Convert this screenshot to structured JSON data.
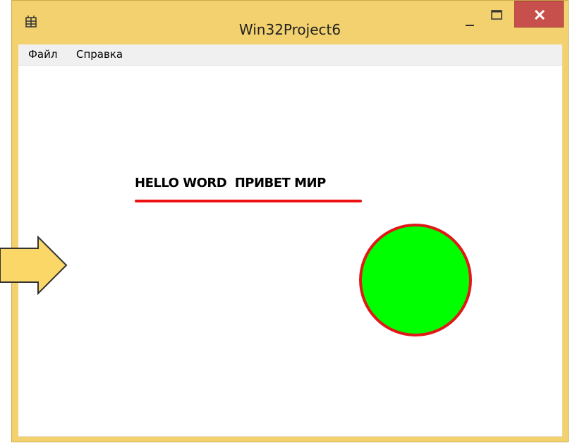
{
  "window": {
    "title": "Win32Project6",
    "frame_color": "#f2d16e",
    "close_button_color": "#c7504c"
  },
  "menu": {
    "items": [
      {
        "label": "Файл"
      },
      {
        "label": "Справка"
      }
    ]
  },
  "canvas": {
    "text": "HELLO WORD  ПРИВЕТ МИР",
    "text_color": "#000000",
    "underline_color": "#ee1111",
    "circle_fill": "#00ff00",
    "circle_border": "#e01818"
  },
  "overlay": {
    "arrow_fill": "#fbd767",
    "arrow_stroke": "#333333"
  },
  "icons": {
    "app": "app-icon",
    "minimize": "minimize-icon",
    "maximize": "maximize-icon",
    "close": "close-icon",
    "arrow": "arrow-right-icon"
  }
}
